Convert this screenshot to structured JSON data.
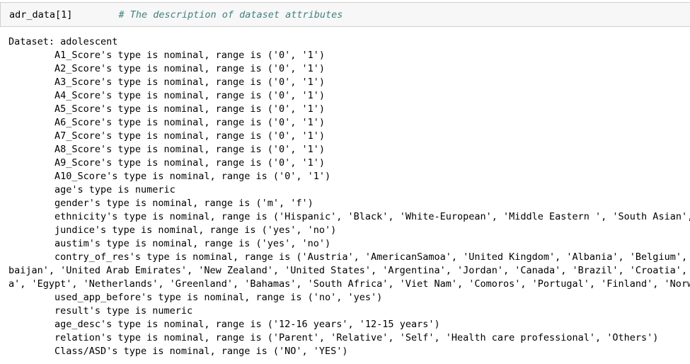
{
  "input_cell": {
    "code": "adr_data[1]",
    "spacer": "        ",
    "comment": "# The description of dataset attributes"
  },
  "output": {
    "lines": [
      "Dataset: adolescent",
      "\tA1_Score's type is nominal, range is ('0', '1')",
      "\tA2_Score's type is nominal, range is ('0', '1')",
      "\tA3_Score's type is nominal, range is ('0', '1')",
      "\tA4_Score's type is nominal, range is ('0', '1')",
      "\tA5_Score's type is nominal, range is ('0', '1')",
      "\tA6_Score's type is nominal, range is ('0', '1')",
      "\tA7_Score's type is nominal, range is ('0', '1')",
      "\tA8_Score's type is nominal, range is ('0', '1')",
      "\tA9_Score's type is nominal, range is ('0', '1')",
      "\tA10_Score's type is nominal, range is ('0', '1')",
      "\tage's type is numeric",
      "\tgender's type is nominal, range is ('m', 'f')",
      "\tethnicity's type is nominal, range is ('Hispanic', 'Black', 'White-European', 'Middle Eastern ', 'South Asian', ",
      "\tjundice's type is nominal, range is ('yes', 'no')",
      "\taustim's type is nominal, range is ('yes', 'no')",
      "\tcontry_of_res's type is nominal, range is ('Austria', 'AmericanSamoa', 'United Kingdom', 'Albania', 'Belgium', '",
      "baijan', 'United Arab Emirates', 'New Zealand', 'United States', 'Argentina', 'Jordan', 'Canada', 'Brazil', 'Croatia', '",
      "a', 'Egypt', 'Netherlands', 'Greenland', 'Bahamas', 'South Africa', 'Viet Nam', 'Comoros', 'Portugal', 'Finland', 'Norwa",
      "\tused_app_before's type is nominal, range is ('no', 'yes')",
      "\tresult's type is numeric",
      "\tage_desc's type is nominal, range is ('12-16 years', '12-15 years')",
      "\trelation's type is nominal, range is ('Parent', 'Relative', 'Self', 'Health care professional', 'Others')",
      "\tClass/ASD's type is nominal, range is ('NO', 'YES')"
    ]
  }
}
